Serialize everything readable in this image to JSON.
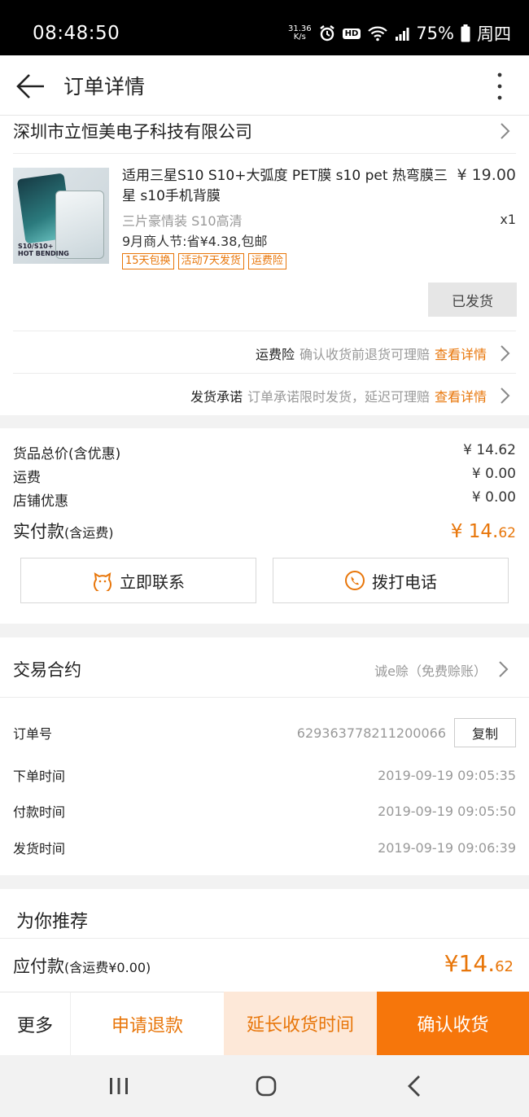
{
  "status_bar": {
    "time": "08:48:50",
    "net_speed_top": "31.36",
    "net_speed_unit": "K/s",
    "hd_badge": "HD",
    "battery": "75%",
    "day": "周四"
  },
  "header": {
    "title": "订单详情"
  },
  "shop": {
    "name": "深圳市立恒美电子科技有限公司",
    "product": {
      "thumb_text": "S10/S10+",
      "thumb_sub": "HOT BENDING",
      "name": "适用三星S10 S10+大弧度 PET膜 s10 pet 热弯膜三星 s10手机背膜",
      "price": "¥ 19.00",
      "sku": "三片豪情装 S10高清",
      "qty": "x1",
      "promo": "9月商人节:省¥4.38,包邮",
      "tags": [
        "15天包换",
        "活动7天发货",
        "运费险"
      ],
      "status_button": "已发货"
    },
    "services": [
      {
        "key": "运费险",
        "desc": "确认收货前退货可理赔",
        "link": "查看详情"
      },
      {
        "key": "发货承诺",
        "desc": "订单承诺限时发货，延迟可理赔",
        "link": "查看详情"
      }
    ]
  },
  "payment": {
    "rows": [
      {
        "label": "货品总价(含优惠)",
        "amount": "¥ 14.62"
      },
      {
        "label": "运费",
        "amount": "¥ 0.00"
      },
      {
        "label": "店铺优惠",
        "amount": "¥ 0.00"
      }
    ],
    "actual_label": "实付款",
    "actual_note": "(含运费)",
    "actual_amount_main": "¥ 14.",
    "actual_amount_cents": "62",
    "contact_button": "立即联系",
    "call_button": "拨打电话"
  },
  "contract": {
    "title": "交易合约",
    "right": "诚e赊（免费赊账）",
    "order_no_label": "订单号",
    "order_no": "629363778211200066",
    "copy_button": "复制",
    "times": [
      {
        "label": "下单时间",
        "value": "2019-09-19 09:05:35"
      },
      {
        "label": "付款时间",
        "value": "2019-09-19 09:05:50"
      },
      {
        "label": "发货时间",
        "value": "2019-09-19 09:06:39"
      }
    ]
  },
  "recommend": {
    "title": "为你推荐"
  },
  "due": {
    "label": "应付款",
    "note": "(含运费¥0.00)",
    "amount_main": "¥14.",
    "amount_cents": "62"
  },
  "bottom_bar": {
    "more": "更多",
    "refund": "申请退款",
    "extend": "延长收货时间",
    "confirm": "确认收货"
  },
  "colors": {
    "accent": "#f6760b",
    "accent_text": "#e8760a",
    "extend_bg": "#fde8d8"
  }
}
